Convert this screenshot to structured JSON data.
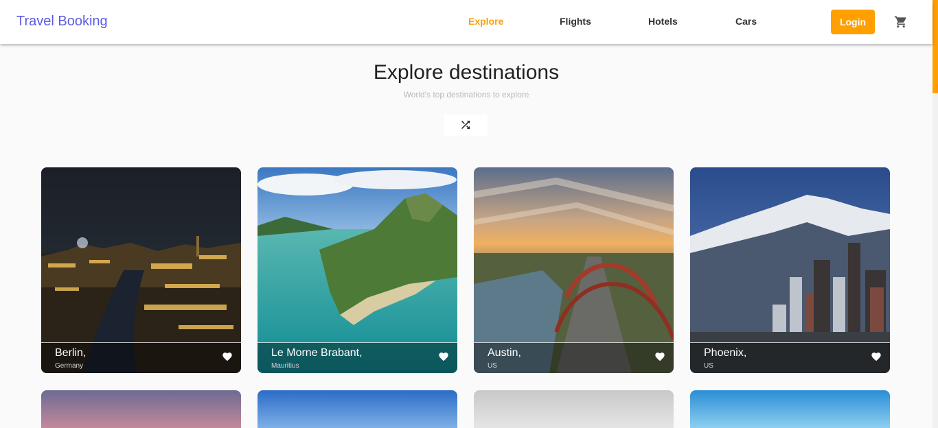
{
  "header": {
    "brand": "Travel Booking",
    "nav": [
      {
        "label": "Explore",
        "active": true
      },
      {
        "label": "Flights",
        "active": false
      },
      {
        "label": "Hotels",
        "active": false
      },
      {
        "label": "Cars",
        "active": false
      }
    ],
    "login_label": "Login",
    "cart_icon": "cart-icon"
  },
  "main": {
    "title": "Explore destinations",
    "subtitle": "World's top destinations to explore",
    "shuffle_icon": "shuffle-icon"
  },
  "destinations": [
    {
      "city": "Berlin,",
      "country": "Germany",
      "image": "night city skyline with river"
    },
    {
      "city": "Le Morne Brabant,",
      "country": "Mauritius",
      "image": "green mountain peninsula with turquoise lagoon"
    },
    {
      "city": "Austin,",
      "country": "US",
      "image": "red arch bridge at sunset"
    },
    {
      "city": "Phoenix,",
      "country": "US",
      "image": "downtown skyscrapers with snowy mountains"
    }
  ],
  "colors": {
    "accent": "#ff9f00",
    "brand": "#5c5ce0",
    "background": "#fafafa"
  },
  "favorite_icon": "heart-icon"
}
